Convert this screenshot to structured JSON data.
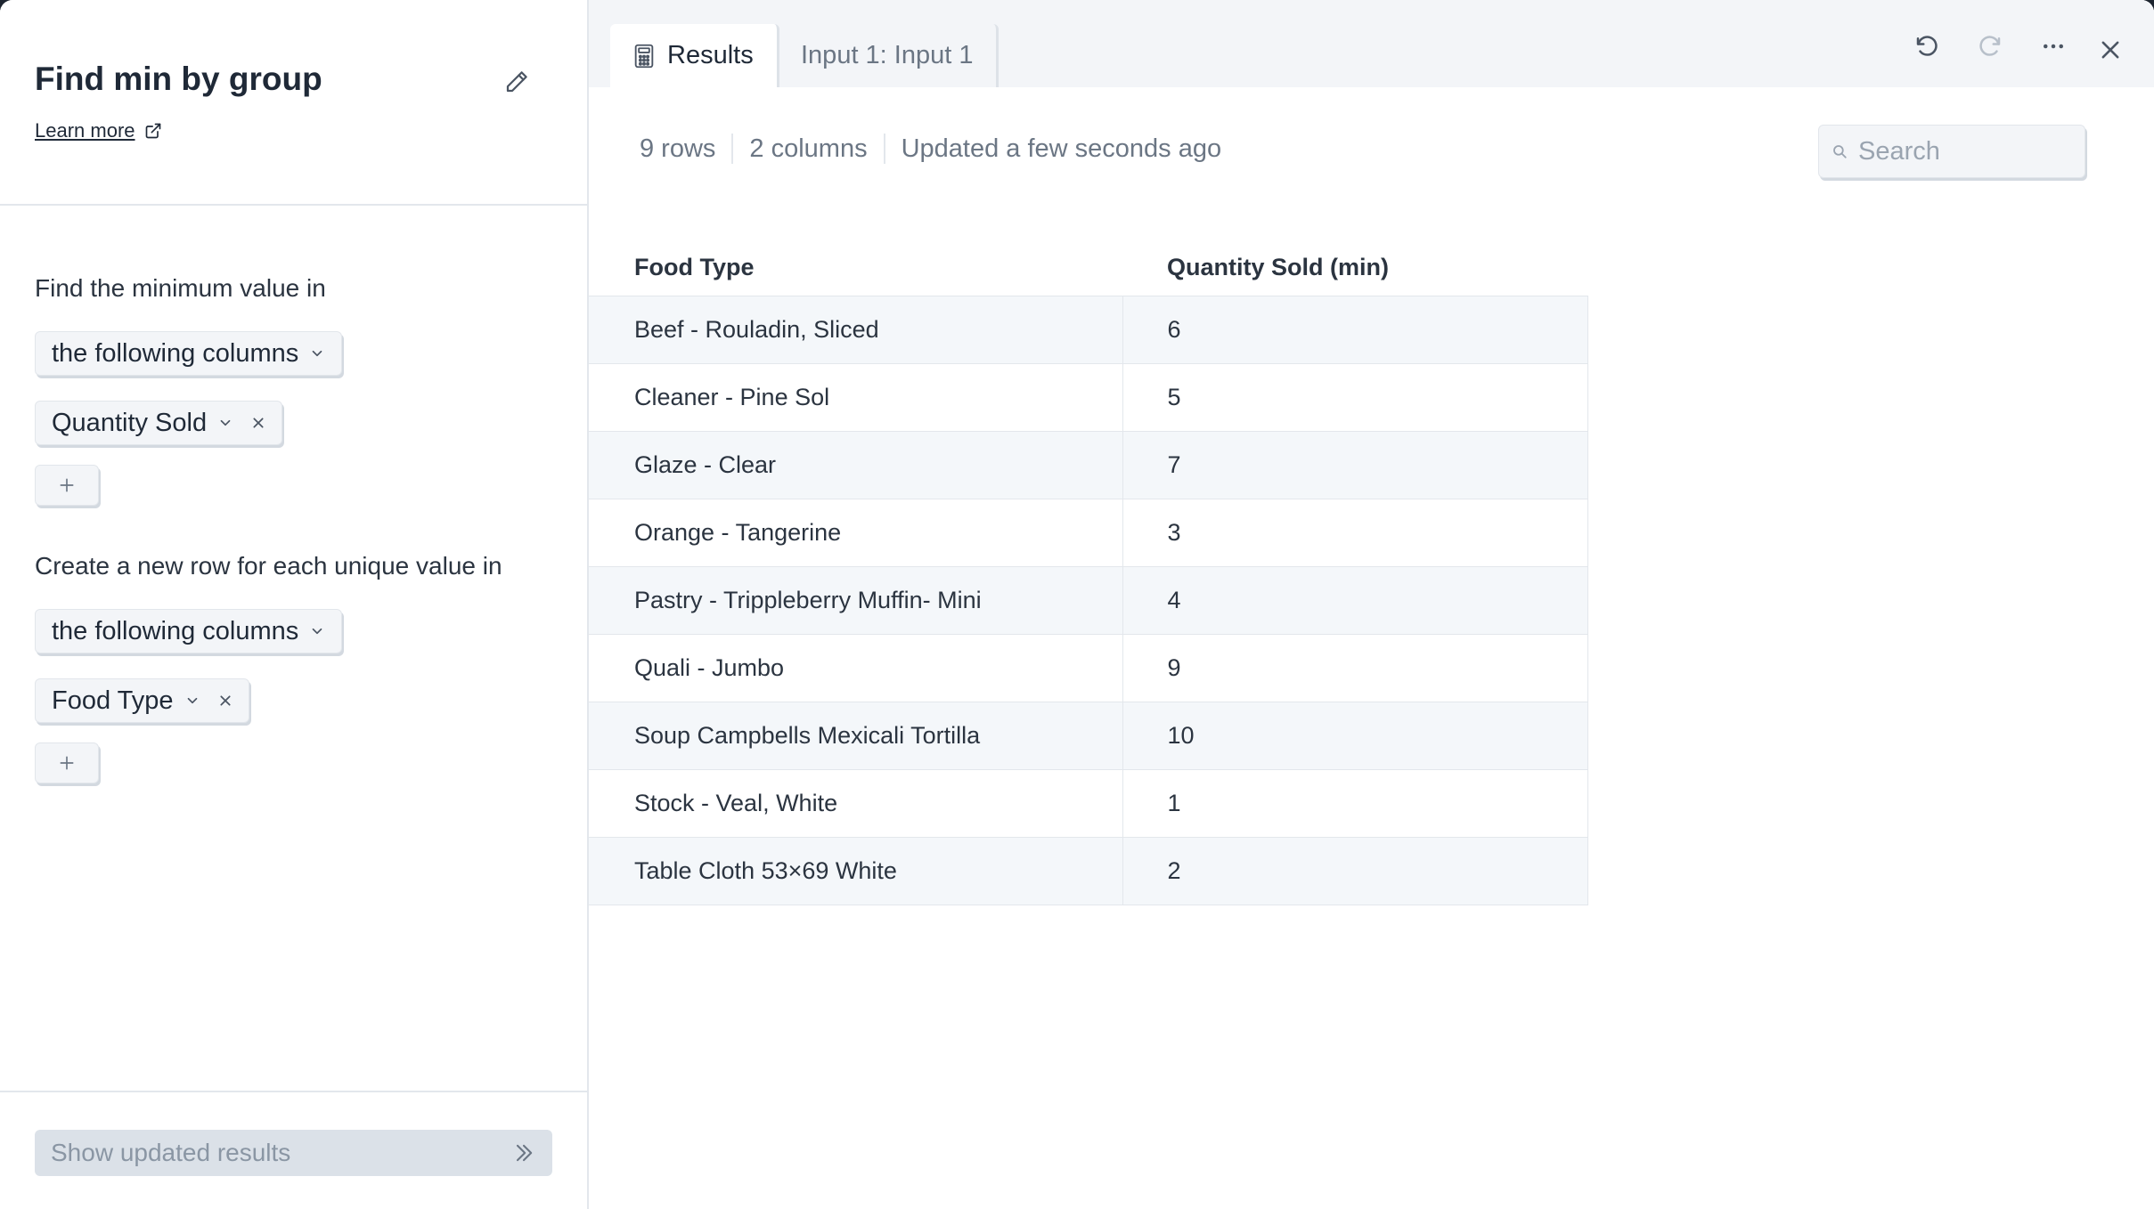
{
  "panel": {
    "title": "Find min by group",
    "learn_more": "Learn more",
    "section1_label": "Find the minimum value in",
    "section1_mode": "the following columns",
    "section1_column": "Quantity Sold",
    "section2_label": "Create a new row for each unique value in",
    "section2_mode": "the following columns",
    "section2_column": "Food Type",
    "show_results": "Show updated results"
  },
  "tabs": [
    {
      "label": "Results",
      "icon": "calculator-icon"
    },
    {
      "label": "Input 1: Input 1"
    }
  ],
  "meta": {
    "rows": "9 rows",
    "columns": "2 columns",
    "updated": "Updated a few seconds ago"
  },
  "search": {
    "placeholder": "Search"
  },
  "table": {
    "headers": [
      "Food Type",
      "Quantity Sold (min)"
    ],
    "rows": [
      [
        "Beef - Rouladin, Sliced",
        "6"
      ],
      [
        "Cleaner - Pine Sol",
        "5"
      ],
      [
        "Glaze - Clear",
        "7"
      ],
      [
        "Orange - Tangerine",
        "3"
      ],
      [
        "Pastry - Trippleberry Muffin- Mini",
        "4"
      ],
      [
        "Quali - Jumbo",
        "9"
      ],
      [
        "Soup Campbells Mexicali Tortilla",
        "10"
      ],
      [
        "Stock - Veal, White",
        "1"
      ],
      [
        "Table Cloth 53×69 White",
        "2"
      ]
    ]
  },
  "colors": {
    "accent_bg": "#f3f5f8",
    "border": "#e3e7ec",
    "text": "#1f2937",
    "muted": "#6b7684",
    "row_alt": "#f4f7fa"
  }
}
